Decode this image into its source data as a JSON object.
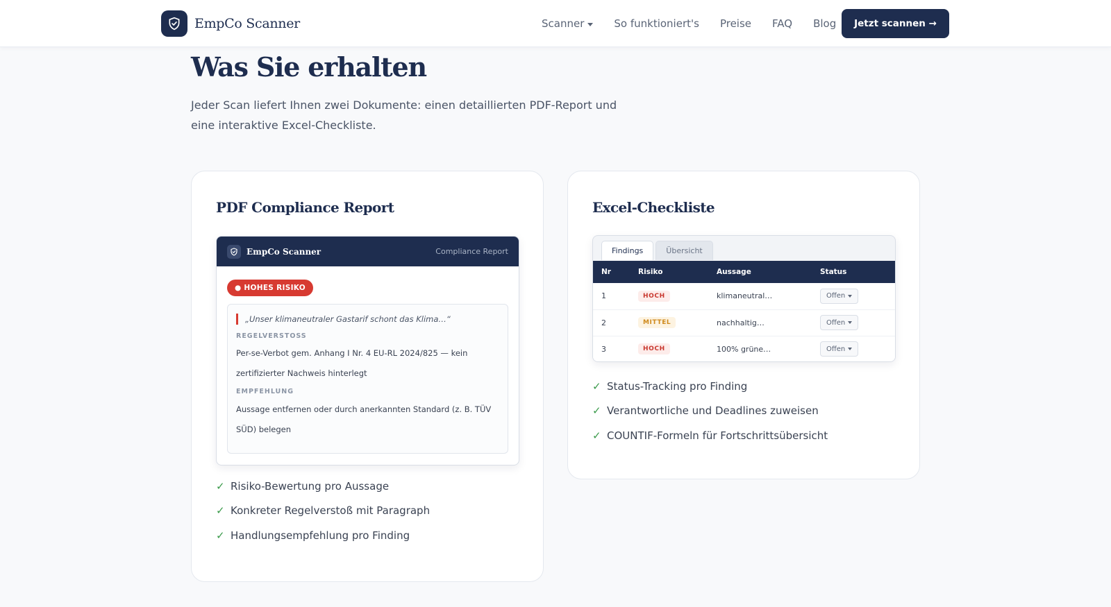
{
  "header": {
    "logo_text": "EmpCo Scanner",
    "nav": [
      {
        "label": "Scanner",
        "has_dropdown": true
      },
      {
        "label": "So funktioniert's"
      },
      {
        "label": "Preise"
      },
      {
        "label": "FAQ"
      },
      {
        "label": "Blog"
      }
    ],
    "cta_label": "Jetzt scannen →"
  },
  "section": {
    "title": "Was Sie erhalten",
    "lead": "Jeder Scan liefert Ihnen zwei Dokumente: einen detaillierten PDF-Report und eine interaktive Excel-Checkliste."
  },
  "pdf_card": {
    "title": "PDF Compliance Report",
    "mock": {
      "brand": "EmpCo Scanner",
      "header_right": "Compliance Report",
      "risk_badge": "● HOHES RISIKO",
      "quote": "„Unser klimaneutraler Gastarif schont das Klima…“",
      "violation_label": "REGELVERSTOSS",
      "violation_text": "Per-se-Verbot gem. Anhang I Nr. 4 EU-RL 2024/825 — kein zertifizierter Nachweis hinterlegt",
      "recommendation_label": "EMPFEHLUNG",
      "recommendation_text": "Aussage entfernen oder durch anerkannten Standard (z. B. TÜV SÜD) belegen"
    },
    "features": [
      "Risiko-Bewertung pro Aussage",
      "Konkreter Regelverstoß mit Paragraph",
      "Handlungsempfehlung pro Finding"
    ]
  },
  "xls_card": {
    "title": "Excel-Checkliste",
    "tabs": [
      "Findings",
      "Übersicht"
    ],
    "columns": [
      "Nr",
      "Risiko",
      "Aussage",
      "Status"
    ],
    "rows": [
      {
        "nr": "1",
        "risk": "HOCH",
        "claim": "klimaneutral…",
        "status": "Offen"
      },
      {
        "nr": "2",
        "risk": "MITTEL",
        "claim": "nachhaltig…",
        "status": "Offen"
      },
      {
        "nr": "3",
        "risk": "HOCH",
        "claim": "100% grüne…",
        "status": "Offen"
      }
    ],
    "features": [
      "Status-Tracking pro Finding",
      "Verantwortliche und Deadlines zuweisen",
      "COUNTIF-Formeln für Fortschrittsübersicht"
    ]
  },
  "colors": {
    "navy": "#1e2d4f",
    "risk_red": "#d73a31",
    "risk_orange": "#cf8a1d",
    "check_green": "#3a9a4a",
    "page_bg": "#f8f9fb"
  },
  "icons": {
    "logo": "shield-check-icon",
    "feature": "check-icon"
  }
}
